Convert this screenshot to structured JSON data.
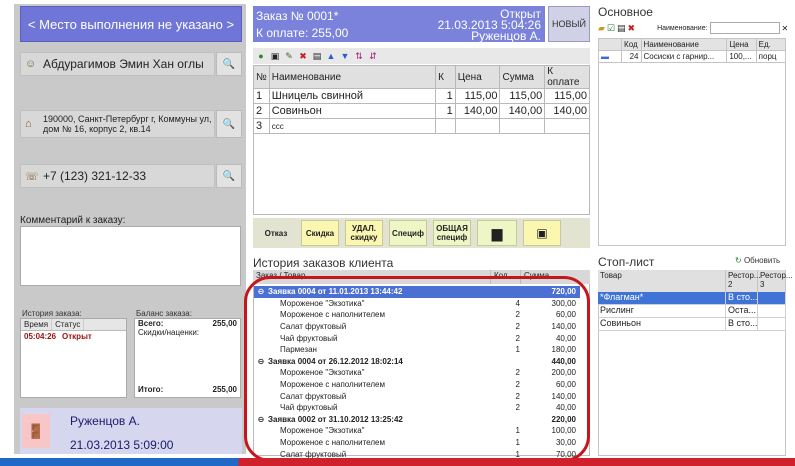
{
  "left": {
    "place_button": "< Место выполнения не указано >",
    "customer_name": "Абдурагимов Эмин Хан оглы",
    "address": "190000, Санкт-Петербург г, Коммуны ул, дом № 16, корпус 2, кв.14",
    "phone": "+7 (123) 321-12-33",
    "comment_label": "Комментарий к заказу:",
    "history_label": "История заказа:",
    "history_cols": [
      "Время",
      "Статус"
    ],
    "history_row": {
      "time": "05:04:26",
      "status": "Открыт"
    },
    "balance_label": "Баланс заказа:",
    "balance_total_label": "Всего:",
    "balance_total": "255,00",
    "balance_discount_label": "Скидки/наценки:",
    "balance_result_label": "Итого:",
    "balance_result": "255,00",
    "user_name": "Руженцов А.",
    "user_time": "21.03.2013 5:09:00"
  },
  "order": {
    "title": "Заказ № 0001*",
    "status": "Открыт",
    "datetime": "21.03.2013 5:04:26",
    "to_pay": "К оплате: 255,00",
    "waiter": "Руженцов А.",
    "new_button": "НОВЫЙ",
    "columns": [
      "№",
      "Наименование",
      "К",
      "Цена",
      "Сумма",
      "К оплате"
    ],
    "rows": [
      {
        "n": "1",
        "name": "Шницель свинной",
        "k": "1",
        "price": "115,00",
        "sum": "115,00",
        "pay": "115,00"
      },
      {
        "n": "2",
        "name": "Совиньон",
        "k": "1",
        "price": "140,00",
        "sum": "140,00",
        "pay": "140,00"
      },
      {
        "n": "3",
        "name": "ссс",
        "k": "",
        "price": "",
        "sum": "",
        "pay": ""
      }
    ],
    "buttons": {
      "refuse": "Отказ",
      "discount": "Скидка",
      "remove_discount_1": "УДАЛ.",
      "remove_discount_2": "скидку",
      "spec": "Специф",
      "general_spec_1": "ОБЩАЯ",
      "general_spec_2": "специф"
    }
  },
  "history": {
    "title": "История заказов клиента",
    "cols": [
      "Заказ / Товар",
      "Кол.",
      "Сумма"
    ],
    "rows": [
      {
        "kind": "group",
        "text": "Заявка 0004 от 11.01.2013 13:44:42",
        "qty": "",
        "sum": "720,00",
        "selected": true
      },
      {
        "kind": "item",
        "text": "Мороженое \"Экзотика\"",
        "qty": "4",
        "sum": "300,00"
      },
      {
        "kind": "item",
        "text": "Мороженое с наполнителем",
        "qty": "2",
        "sum": "60,00"
      },
      {
        "kind": "item",
        "text": "Салат фруктовый",
        "qty": "2",
        "sum": "140,00"
      },
      {
        "kind": "item",
        "text": "Чай фруктовый",
        "qty": "2",
        "sum": "40,00"
      },
      {
        "kind": "item",
        "text": "Пармезан",
        "qty": "1",
        "sum": "180,00"
      },
      {
        "kind": "group",
        "text": "Заявка 0004 от 26.12.2012 18:02:14",
        "qty": "",
        "sum": "440,00",
        "selected": false
      },
      {
        "kind": "item",
        "text": "Мороженое \"Экзотика\"",
        "qty": "2",
        "sum": "200,00"
      },
      {
        "kind": "item",
        "text": "Мороженое с наполнителем",
        "qty": "2",
        "sum": "60,00"
      },
      {
        "kind": "item",
        "text": "Салат фруктовый",
        "qty": "2",
        "sum": "140,00"
      },
      {
        "kind": "item",
        "text": "Чай фруктовый",
        "qty": "2",
        "sum": "40,00"
      },
      {
        "kind": "group",
        "text": "Заявка 0002 от 31.10.2012 13:25:42",
        "qty": "",
        "sum": "220,00",
        "selected": false
      },
      {
        "kind": "item",
        "text": "Мороженое \"Экзотика\"",
        "qty": "1",
        "sum": "100,00"
      },
      {
        "kind": "item",
        "text": "Мороженое с наполнителем",
        "qty": "1",
        "sum": "30,00"
      },
      {
        "kind": "item",
        "text": "Салат фруктовый",
        "qty": "1",
        "sum": "70,00"
      }
    ]
  },
  "right": {
    "title": "Основное",
    "search_label": "Наименование:",
    "cols": [
      "",
      "Код",
      "Наименование",
      "Цена",
      "Ед."
    ],
    "row": {
      "code": "24",
      "name": "Сосиски с гарнир...",
      "price": "100,...",
      "unit": "порц"
    },
    "stop_title": "Стоп-лист",
    "refresh": "Обновить",
    "stop_cols": [
      "Товар",
      "Рестор... 2",
      "Рестор... 3"
    ],
    "stop_rows": [
      {
        "name": "*Флагман*",
        "r2": "В сто...",
        "selected": true
      },
      {
        "name": "Рислинг",
        "r2": "Оста...",
        "selected": false
      },
      {
        "name": "Совиньон",
        "r2": "В сто...",
        "selected": false
      }
    ]
  },
  "colors": {
    "accent": "#7a82dc",
    "highlight": "#c4161c",
    "selection": "#4b6fd2"
  }
}
